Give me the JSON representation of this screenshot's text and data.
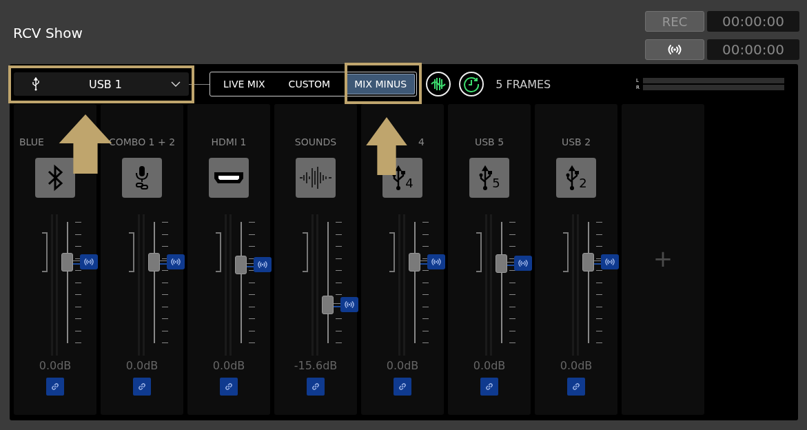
{
  "title": "RCV Show",
  "record": {
    "rec_label": "REC",
    "rec_time": "00:00:00",
    "stream_time": "00:00:00"
  },
  "source": {
    "label": "USB 1"
  },
  "modes": [
    {
      "label": "LIVE MIX",
      "selected": false
    },
    {
      "label": "CUSTOM",
      "selected": false
    },
    {
      "label": "MIX MINUS",
      "selected": true
    }
  ],
  "delay": "5 FRAMES",
  "meter_labels": [
    "L",
    "R"
  ],
  "channels": [
    {
      "label": "BLUE",
      "kind": "bluetooth",
      "level": 0.67,
      "reading": "0.0dB"
    },
    {
      "label": "COMBO 1 + 2",
      "kind": "mic",
      "level": 0.67,
      "reading": "0.0dB"
    },
    {
      "label": "HDMI 1",
      "kind": "hdmi",
      "level": 0.65,
      "reading": "0.0dB"
    },
    {
      "label": "SOUNDS",
      "kind": "sounds",
      "level": 0.32,
      "reading": "-15.6dB"
    },
    {
      "label": "4",
      "kind": "usb",
      "number": "4",
      "level": 0.67,
      "reading": "0.0dB"
    },
    {
      "label": "USB 5",
      "kind": "usb",
      "number": "5",
      "level": 0.66,
      "reading": "0.0dB"
    },
    {
      "label": "USB 2",
      "kind": "usb",
      "number": "2",
      "level": 0.67,
      "reading": "0.0dB"
    }
  ],
  "add_channel": "+"
}
